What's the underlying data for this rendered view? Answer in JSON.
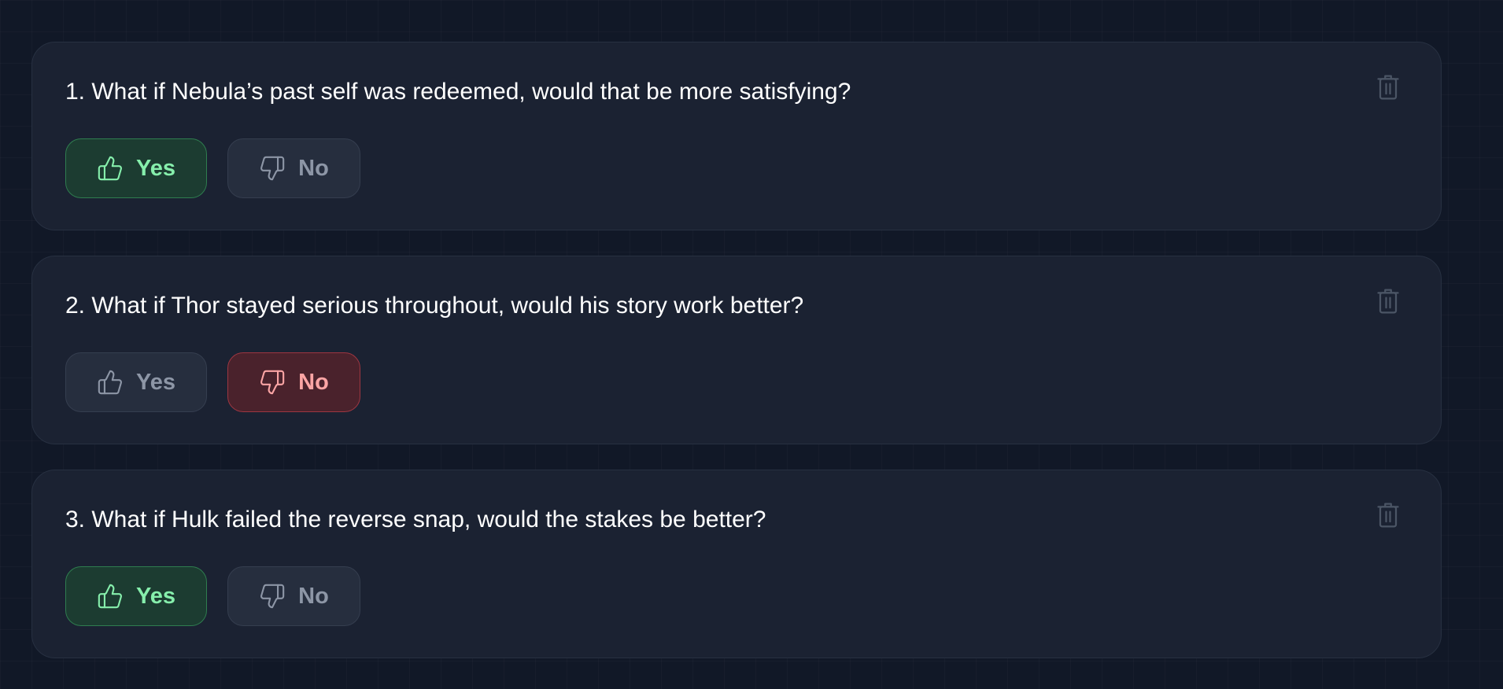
{
  "questions": [
    {
      "text": "1. What if Nebula’s past self was redeemed, would that be more satisfying?",
      "yes_label": "Yes",
      "no_label": "No",
      "selected": "yes"
    },
    {
      "text": "2. What if Thor stayed serious throughout, would his story work better?",
      "yes_label": "Yes",
      "no_label": "No",
      "selected": "no"
    },
    {
      "text": "3. What if Hulk failed the reverse snap, would the stakes be better?",
      "yes_label": "Yes",
      "no_label": "No",
      "selected": "yes"
    }
  ],
  "icons": {
    "yes": "thumbs-up-icon",
    "no": "thumbs-down-icon",
    "delete": "trash-icon"
  },
  "colors": {
    "background": "#111827",
    "card": "#1b2232",
    "yes_selected": "#86efac",
    "no_selected": "#fca5a5",
    "unselected_text": "#8d96a6",
    "trash": "#4b5565"
  }
}
